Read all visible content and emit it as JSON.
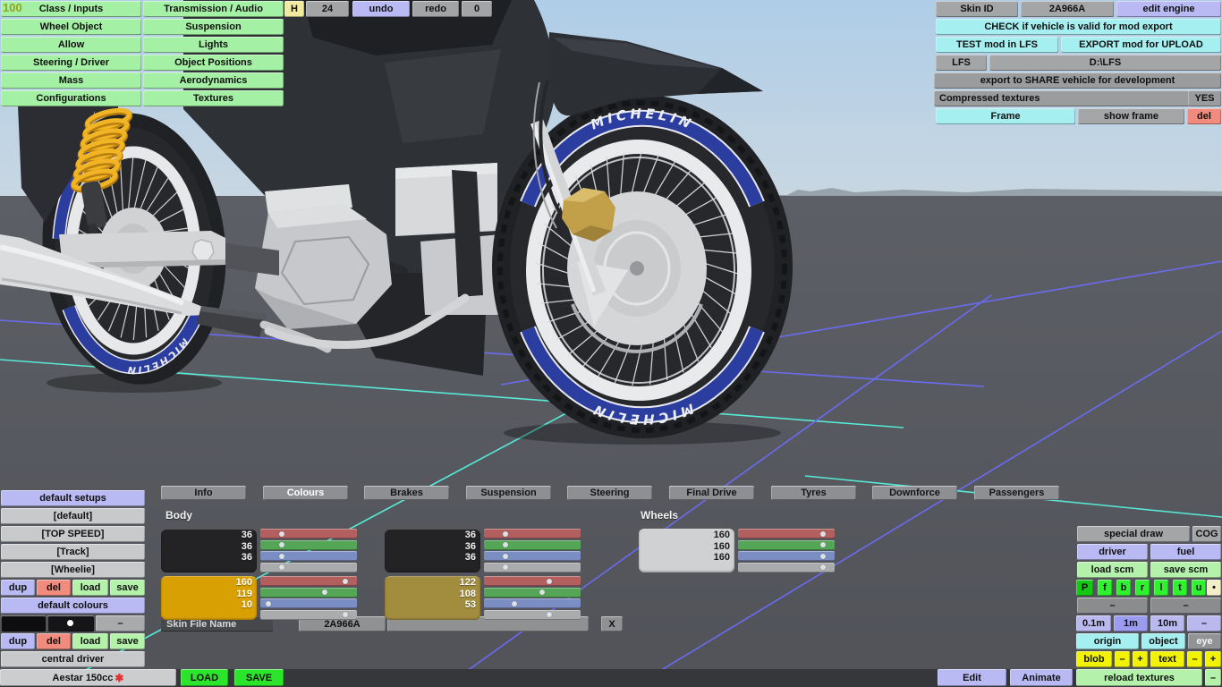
{
  "viewport": {
    "counter": "100",
    "tire_brand": "MICHELIN"
  },
  "menu": {
    "columns": [
      [
        "Class / Inputs",
        "Wheel Object",
        "Allow",
        "Steering / Driver",
        "Mass",
        "Configurations"
      ],
      [
        "Transmission / Audio",
        "Suspension",
        "Lights",
        "Object Positions",
        "Aerodynamics",
        "Textures"
      ]
    ],
    "button_color": "#a4f0a4"
  },
  "topbar": [
    {
      "label": "H",
      "bg": "#f2ea9e"
    },
    {
      "label": "24",
      "bg": "#a2a4a6"
    },
    {
      "label": "undo",
      "bg": "#b9b9f4"
    },
    {
      "label": "redo",
      "bg": "#a2a4a6"
    },
    {
      "label": "0",
      "bg": "#a2a4a6"
    }
  ],
  "top_right": [
    {
      "label": "Skin ID",
      "bg": "#a3a5a7"
    },
    {
      "label": "2A966A",
      "bg": "#a3a5a7"
    },
    {
      "label": "edit engine",
      "bg": "#b9b9f4"
    },
    {
      "label": "CHECK if vehicle is valid for mod export",
      "bg": "#a6eff1"
    },
    {
      "label": "TEST mod in LFS",
      "bg": "#a6eff1"
    },
    {
      "label": "EXPORT mod for UPLOAD",
      "bg": "#a6eff1"
    },
    {
      "label": "LFS",
      "bg": "#a3a5a7"
    },
    {
      "label": "D:\\LFS",
      "bg": "#a3a5a7"
    },
    {
      "label": "export to SHARE vehicle for development",
      "bg": "#9a9c9e"
    },
    {
      "label": "Compressed textures",
      "bg": "#9a9c9e"
    },
    {
      "label": "YES",
      "bg": "#9a9c9e"
    },
    {
      "label": "Frame",
      "bg": "#a6eff1"
    },
    {
      "label": "show frame",
      "bg": "#a3a5a7"
    },
    {
      "label": "del",
      "bg": "#f18b7d"
    }
  ],
  "tabs": {
    "items": [
      "Info",
      "Colours",
      "Brakes",
      "Suspension",
      "Steering",
      "Final Drive",
      "Tyres",
      "Downforce",
      "Passengers"
    ],
    "active": "Colours"
  },
  "colours_panel": {
    "body_label": "Body",
    "wheels_label": "Wheels",
    "slider_colors": [
      "#b35f5f",
      "#55a557",
      "#7b8ec3",
      "#a9abad"
    ],
    "body_swatches": [
      {
        "values": [
          36,
          36,
          36
        ],
        "hex": "#232325",
        "text_color": "#f2f2f2"
      },
      {
        "values": [
          36,
          36,
          36
        ],
        "hex": "#232325",
        "text_color": "#f2f2f2"
      },
      {
        "values": [
          160,
          119,
          10
        ],
        "hex": "#d9a004",
        "text_color": "#ffffff"
      },
      {
        "values": [
          122,
          108,
          53
        ],
        "hex": "#a28c3e",
        "text_color": "#ffffff"
      }
    ],
    "wheel_swatches": [
      {
        "values": [
          160,
          160,
          160
        ],
        "hex": "#d0d1d3",
        "text_color": "#1b1b1b"
      }
    ],
    "skin_file_name_label": "Skin File Name",
    "skin_file_value": "2A966A",
    "clear_button": "X"
  },
  "left_panel": {
    "buttons": [
      {
        "label": "default setups",
        "bg": "#b9b9f4"
      },
      {
        "label": "[default]",
        "bg": "#c7c9cb"
      },
      {
        "label": "[TOP SPEED]",
        "bg": "#c7c9cb"
      },
      {
        "label": "[Track]",
        "bg": "#c7c9cb"
      },
      {
        "label": "[Wheelie]",
        "bg": "#c7c9cb"
      },
      {
        "label": "dup",
        "bg": "#b9b9f4"
      },
      {
        "label": "del",
        "bg": "#f18b7d"
      },
      {
        "label": "load",
        "bg": "#b4f2ac"
      },
      {
        "label": "save",
        "bg": "#b4f2ac"
      },
      {
        "label": "default colours",
        "bg": "#b9b9f4"
      },
      {
        "label": "dup",
        "bg": "#b9b9f4"
      },
      {
        "label": "del",
        "bg": "#f18b7d"
      },
      {
        "label": "load",
        "bg": "#b4f2ac"
      },
      {
        "label": "save",
        "bg": "#b4f2ac"
      },
      {
        "label": "central driver",
        "bg": "#c7c9cb"
      }
    ],
    "swatch_minus": "–"
  },
  "right_panel": [
    {
      "label": "special draw",
      "bg": "#a3a5a7"
    },
    {
      "label": "COG",
      "bg": "#a3a5a7"
    },
    {
      "label": "driver",
      "bg": "#b9b9f4"
    },
    {
      "label": "fuel",
      "bg": "#b9b9f4"
    },
    {
      "label": "load scm",
      "bg": "#b4f2ac"
    },
    {
      "label": "save scm",
      "bg": "#b4f2ac"
    },
    {
      "label": "P",
      "bg": "#14c814"
    },
    {
      "label": "f",
      "bg": "#2df22d"
    },
    {
      "label": "b",
      "bg": "#2df22d"
    },
    {
      "label": "r",
      "bg": "#2df22d"
    },
    {
      "label": "l",
      "bg": "#2df22d"
    },
    {
      "label": "t",
      "bg": "#2df22d"
    },
    {
      "label": "u",
      "bg": "#2df22d"
    },
    {
      "label": "•",
      "bg": "#f2eec8"
    },
    {
      "label": "–",
      "bg": "#8a8c8e"
    },
    {
      "label": "–",
      "bg": "#8a8c8e"
    },
    {
      "label": "0.1m",
      "bg": "#b9b9f0"
    },
    {
      "label": "1m",
      "bg": "#9c9cee"
    },
    {
      "label": "10m",
      "bg": "#b9b9f0"
    },
    {
      "label": "–",
      "bg": "#b9b9f0"
    },
    {
      "label": "origin",
      "bg": "#a6eff1"
    },
    {
      "label": "object",
      "bg": "#a6eff1"
    },
    {
      "label": "eye",
      "bg": "#919395",
      "fg": "#f4f4f4"
    },
    {
      "label": "blob",
      "bg": "#f2f205"
    },
    {
      "label": "–",
      "bg": "#f2f205"
    },
    {
      "label": "+",
      "bg": "#f2f205"
    },
    {
      "label": "text",
      "bg": "#f2f205"
    },
    {
      "label": "–",
      "bg": "#f2f205"
    },
    {
      "label": "+",
      "bg": "#f2f205"
    }
  ],
  "bottom_bar": {
    "vehicle_name": "Aestar 150cc",
    "modified_marker": "✱",
    "buttons": [
      {
        "label": "LOAD",
        "bg": "#2be52b"
      },
      {
        "label": "SAVE",
        "bg": "#2be52b"
      },
      {
        "label": "Edit",
        "bg": "#b9b9f4"
      },
      {
        "label": "Animate",
        "bg": "#b9b9f4"
      },
      {
        "label": "reload textures",
        "bg": "#b4f2ac"
      },
      {
        "label": "–",
        "bg": "#b4f2ac"
      }
    ]
  }
}
